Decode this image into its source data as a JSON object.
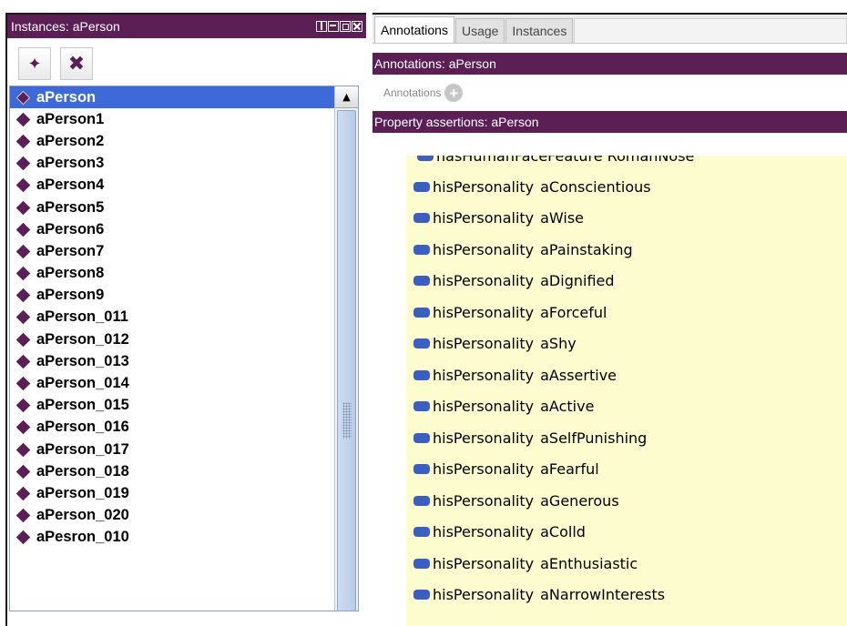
{
  "left_panel": {
    "title": "Instances: aPerson",
    "window_controls": [
      "view",
      "minimize",
      "maximize",
      "close"
    ],
    "toolbar": {
      "add_button_icon": "add-individual-icon",
      "delete_button_icon": "delete-individual-icon"
    },
    "individuals": [
      "aPerson",
      "aPerson1",
      "aPerson2",
      "aPerson3",
      "aPerson4",
      "aPerson5",
      "aPerson6",
      "aPerson7",
      "aPerson8",
      "aPerson9",
      "aPerson_011",
      "aPerson_012",
      "aPerson_013",
      "aPerson_014",
      "aPerson_015",
      "aPerson_016",
      "aPerson_017",
      "aPerson_018",
      "aPerson_019",
      "aPerson_020",
      "aPesron_010"
    ],
    "selected": "aPerson"
  },
  "right_panel": {
    "tabs": [
      "Annotations",
      "Usage",
      "Instances"
    ],
    "active_tab": "Annotations",
    "annotations_header": "Annotations: aPerson",
    "annotations_label": "Annotations",
    "property_assertions_header": "Property assertions: aPerson",
    "partial_row_text": "hasHumanFaceFeature  RomanNose",
    "assertions": [
      {
        "property": "hisPersonality",
        "value": "aConscientious"
      },
      {
        "property": "hisPersonality",
        "value": "aWise"
      },
      {
        "property": "hisPersonality",
        "value": "aPainstaking"
      },
      {
        "property": "hisPersonality",
        "value": "aDignified"
      },
      {
        "property": "hisPersonality",
        "value": "aForceful"
      },
      {
        "property": "hisPersonality",
        "value": "aShy"
      },
      {
        "property": "hisPersonality",
        "value": "aAssertive"
      },
      {
        "property": "hisPersonality",
        "value": "aActive"
      },
      {
        "property": "hisPersonality",
        "value": "aSelfPunishing"
      },
      {
        "property": "hisPersonality",
        "value": "aFearful"
      },
      {
        "property": "hisPersonality",
        "value": "aGenerous"
      },
      {
        "property": "hisPersonality",
        "value": "aColld"
      },
      {
        "property": "hisPersonality",
        "value": "aEnthusiastic"
      },
      {
        "property": "hisPersonality",
        "value": "aNarrowInterests"
      }
    ]
  },
  "colors": {
    "header_purple": "#5b1f55",
    "selection_blue": "#3d6ad8",
    "assertion_bg": "#fcfccf",
    "object_property_blue": "#3b5fc0"
  }
}
